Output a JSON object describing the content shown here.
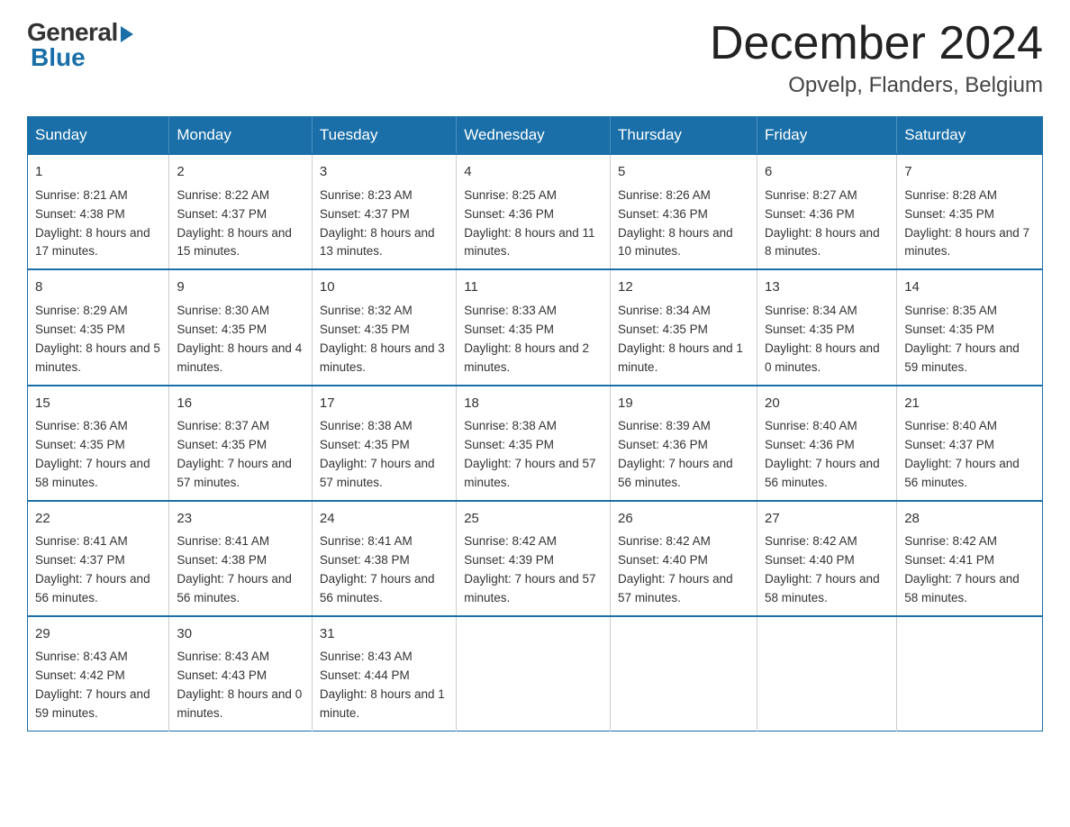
{
  "header": {
    "logo_general": "General",
    "logo_blue": "Blue",
    "month_title": "December 2024",
    "location": "Opvelp, Flanders, Belgium"
  },
  "days_of_week": [
    "Sunday",
    "Monday",
    "Tuesday",
    "Wednesday",
    "Thursday",
    "Friday",
    "Saturday"
  ],
  "weeks": [
    [
      {
        "day": "1",
        "sunrise": "8:21 AM",
        "sunset": "4:38 PM",
        "daylight": "8 hours and 17 minutes."
      },
      {
        "day": "2",
        "sunrise": "8:22 AM",
        "sunset": "4:37 PM",
        "daylight": "8 hours and 15 minutes."
      },
      {
        "day": "3",
        "sunrise": "8:23 AM",
        "sunset": "4:37 PM",
        "daylight": "8 hours and 13 minutes."
      },
      {
        "day": "4",
        "sunrise": "8:25 AM",
        "sunset": "4:36 PM",
        "daylight": "8 hours and 11 minutes."
      },
      {
        "day": "5",
        "sunrise": "8:26 AM",
        "sunset": "4:36 PM",
        "daylight": "8 hours and 10 minutes."
      },
      {
        "day": "6",
        "sunrise": "8:27 AM",
        "sunset": "4:36 PM",
        "daylight": "8 hours and 8 minutes."
      },
      {
        "day": "7",
        "sunrise": "8:28 AM",
        "sunset": "4:35 PM",
        "daylight": "8 hours and 7 minutes."
      }
    ],
    [
      {
        "day": "8",
        "sunrise": "8:29 AM",
        "sunset": "4:35 PM",
        "daylight": "8 hours and 5 minutes."
      },
      {
        "day": "9",
        "sunrise": "8:30 AM",
        "sunset": "4:35 PM",
        "daylight": "8 hours and 4 minutes."
      },
      {
        "day": "10",
        "sunrise": "8:32 AM",
        "sunset": "4:35 PM",
        "daylight": "8 hours and 3 minutes."
      },
      {
        "day": "11",
        "sunrise": "8:33 AM",
        "sunset": "4:35 PM",
        "daylight": "8 hours and 2 minutes."
      },
      {
        "day": "12",
        "sunrise": "8:34 AM",
        "sunset": "4:35 PM",
        "daylight": "8 hours and 1 minute."
      },
      {
        "day": "13",
        "sunrise": "8:34 AM",
        "sunset": "4:35 PM",
        "daylight": "8 hours and 0 minutes."
      },
      {
        "day": "14",
        "sunrise": "8:35 AM",
        "sunset": "4:35 PM",
        "daylight": "7 hours and 59 minutes."
      }
    ],
    [
      {
        "day": "15",
        "sunrise": "8:36 AM",
        "sunset": "4:35 PM",
        "daylight": "7 hours and 58 minutes."
      },
      {
        "day": "16",
        "sunrise": "8:37 AM",
        "sunset": "4:35 PM",
        "daylight": "7 hours and 57 minutes."
      },
      {
        "day": "17",
        "sunrise": "8:38 AM",
        "sunset": "4:35 PM",
        "daylight": "7 hours and 57 minutes."
      },
      {
        "day": "18",
        "sunrise": "8:38 AM",
        "sunset": "4:35 PM",
        "daylight": "7 hours and 57 minutes."
      },
      {
        "day": "19",
        "sunrise": "8:39 AM",
        "sunset": "4:36 PM",
        "daylight": "7 hours and 56 minutes."
      },
      {
        "day": "20",
        "sunrise": "8:40 AM",
        "sunset": "4:36 PM",
        "daylight": "7 hours and 56 minutes."
      },
      {
        "day": "21",
        "sunrise": "8:40 AM",
        "sunset": "4:37 PM",
        "daylight": "7 hours and 56 minutes."
      }
    ],
    [
      {
        "day": "22",
        "sunrise": "8:41 AM",
        "sunset": "4:37 PM",
        "daylight": "7 hours and 56 minutes."
      },
      {
        "day": "23",
        "sunrise": "8:41 AM",
        "sunset": "4:38 PM",
        "daylight": "7 hours and 56 minutes."
      },
      {
        "day": "24",
        "sunrise": "8:41 AM",
        "sunset": "4:38 PM",
        "daylight": "7 hours and 56 minutes."
      },
      {
        "day": "25",
        "sunrise": "8:42 AM",
        "sunset": "4:39 PM",
        "daylight": "7 hours and 57 minutes."
      },
      {
        "day": "26",
        "sunrise": "8:42 AM",
        "sunset": "4:40 PM",
        "daylight": "7 hours and 57 minutes."
      },
      {
        "day": "27",
        "sunrise": "8:42 AM",
        "sunset": "4:40 PM",
        "daylight": "7 hours and 58 minutes."
      },
      {
        "day": "28",
        "sunrise": "8:42 AM",
        "sunset": "4:41 PM",
        "daylight": "7 hours and 58 minutes."
      }
    ],
    [
      {
        "day": "29",
        "sunrise": "8:43 AM",
        "sunset": "4:42 PM",
        "daylight": "7 hours and 59 minutes."
      },
      {
        "day": "30",
        "sunrise": "8:43 AM",
        "sunset": "4:43 PM",
        "daylight": "8 hours and 0 minutes."
      },
      {
        "day": "31",
        "sunrise": "8:43 AM",
        "sunset": "4:44 PM",
        "daylight": "8 hours and 1 minute."
      },
      null,
      null,
      null,
      null
    ]
  ],
  "labels": {
    "sunrise": "Sunrise:",
    "sunset": "Sunset:",
    "daylight": "Daylight:"
  }
}
